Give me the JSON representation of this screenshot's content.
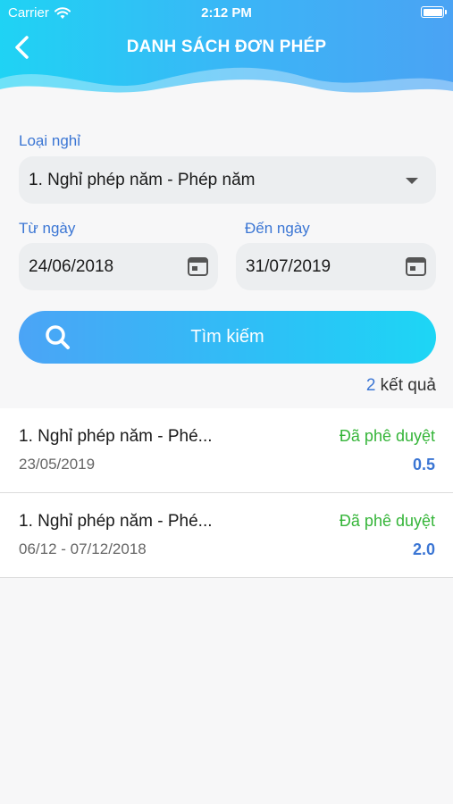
{
  "status_bar": {
    "carrier": "Carrier",
    "time": "2:12 PM"
  },
  "header": {
    "title": "DANH SÁCH ĐƠN PHÉP"
  },
  "filters": {
    "leave_type_label": "Loại nghỉ",
    "leave_type_value": "1. Nghỉ phép năm - Phép năm",
    "from_label": "Từ ngày",
    "from_value": "24/06/2018",
    "to_label": "Đến ngày",
    "to_value": "31/07/2019"
  },
  "search_button": {
    "label": "Tìm kiếm"
  },
  "results": {
    "count": "2",
    "suffix": "kết quả"
  },
  "items": [
    {
      "title": "1. Nghỉ phép năm - Phé...",
      "date": "23/05/2019",
      "status": "Đã phê duyệt",
      "days": "0.5"
    },
    {
      "title": "1. Nghỉ phép năm - Phé...",
      "date": "06/12 - 07/12/2018",
      "status": "Đã phê duyệt",
      "days": "2.0"
    }
  ],
  "colors": {
    "accent": "#3b76d4",
    "approved": "#35b539",
    "gradient_start": "#1fd3f4",
    "gradient_end": "#4aa3f4"
  }
}
